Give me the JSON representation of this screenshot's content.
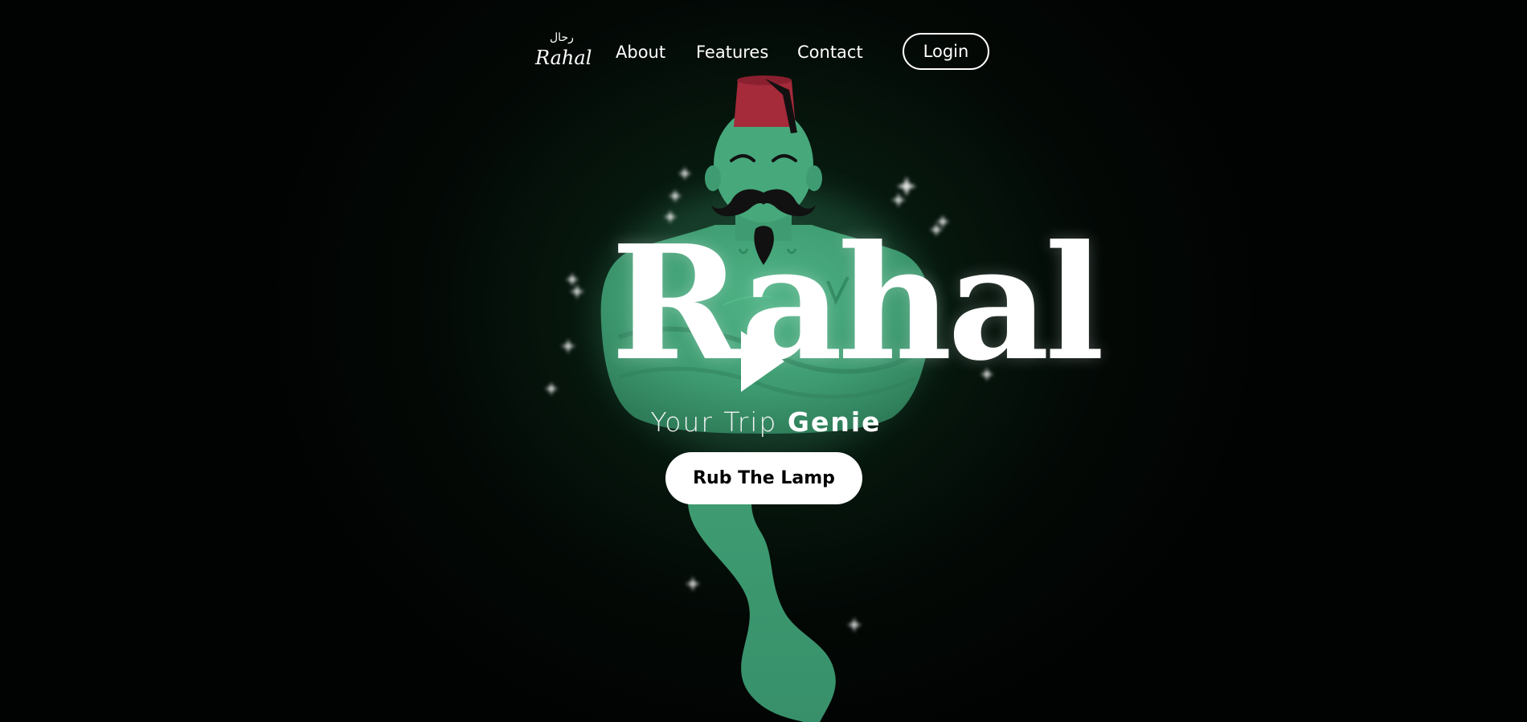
{
  "nav": {
    "logo_arabic": "رحال",
    "logo_text": "Rahal",
    "links": [
      {
        "label": "About"
      },
      {
        "label": "Features"
      },
      {
        "label": "Contact"
      }
    ],
    "login_label": "Login"
  },
  "hero": {
    "title": "Rahal",
    "tagline_light": "Your Trip",
    "tagline_bold": "Genie",
    "cta_label": "Rub The Lamp"
  },
  "colors": {
    "background": "#020503",
    "genie_green": "#3f9c72",
    "fez_red": "#a52a3a",
    "text": "#ffffff",
    "button_bg": "#ffffff"
  },
  "icons": [
    "sparkle-icon",
    "play-icon",
    "genie-illustration"
  ]
}
